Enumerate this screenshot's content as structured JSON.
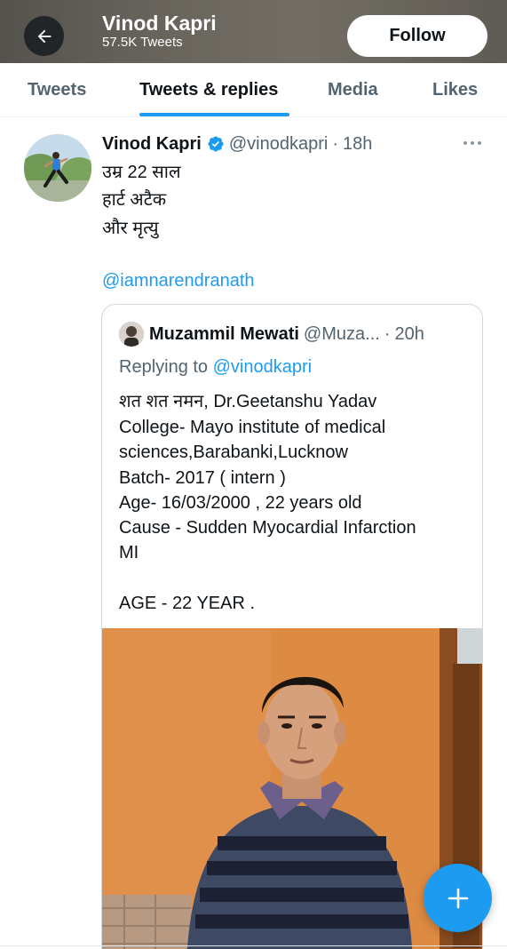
{
  "header": {
    "title": "Vinod Kapri",
    "subtitle": "57.5K Tweets",
    "follow_label": "Follow",
    "back_icon": "arrow-left-icon"
  },
  "tabs": [
    {
      "label": "Tweets",
      "active": false
    },
    {
      "label": "Tweets & replies",
      "active": true
    },
    {
      "label": "Media",
      "active": false
    },
    {
      "label": "Likes",
      "active": false
    }
  ],
  "tweet": {
    "author_name": "Vinod Kapri",
    "verified": true,
    "handle": "@vinodkapri",
    "separator": "·",
    "time": "18h",
    "lines": [
      "उम्र 22 साल",
      "हार्ट अटैक",
      "और मृत्यु"
    ],
    "mention": "@iamnarendranath",
    "more_icon": "more-horizontal-icon"
  },
  "quoted": {
    "author_name": "Muzammil Mewati",
    "handle": "@Muza...",
    "separator": "·",
    "time": "20h",
    "replying_prefix": "Replying to",
    "replying_to": "@vinodkapri",
    "lines": [
      "शत शत नमन, Dr.Geetanshu Yadav",
      "College- Mayo institute of medical",
      "sciences,Barabanki,Lucknow",
      "Batch-  2017 ( intern )",
      "Age- 16/03/2000 , 22 years old",
      "Cause - Sudden Myocardial Infarction",
      "MI",
      "",
      "AGE - 22 YEAR ."
    ]
  },
  "fab": {
    "icon": "plus-icon"
  },
  "colors": {
    "accent": "#1d9bf0",
    "text_primary": "#0f1419",
    "text_secondary": "#536471",
    "border": "#cfd9de"
  }
}
